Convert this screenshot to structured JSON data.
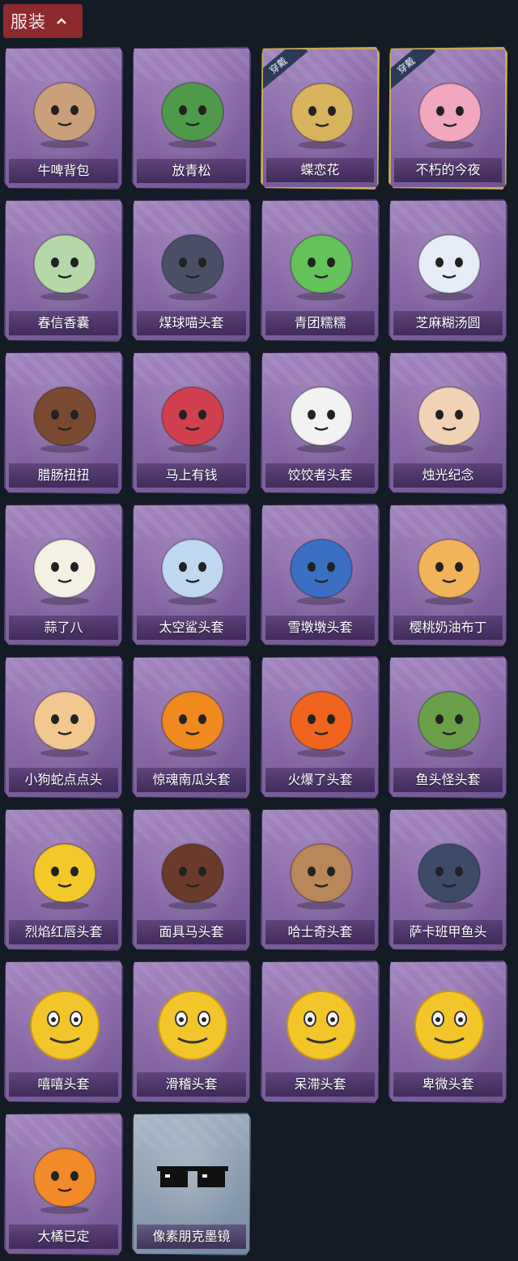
{
  "header": {
    "title": "服装"
  },
  "ribbon_text": "穿戴",
  "items": [
    {
      "name": "牛啤背包",
      "equipped": false,
      "icon": "cow-beer-keg-icon",
      "color": "#c9a07a"
    },
    {
      "name": "放青松",
      "equipped": false,
      "icon": "potted-pine-icon",
      "color": "#4e9a4a"
    },
    {
      "name": "蝶恋花",
      "equipped": true,
      "icon": "butterfly-bell-wreath-icon",
      "color": "#d8b35e"
    },
    {
      "name": "不朽的今夜",
      "equipped": true,
      "icon": "pink-cat-cup-icon",
      "color": "#f2a7c0"
    },
    {
      "name": "春信香囊",
      "equipped": false,
      "icon": "sachet-pouch-icon",
      "color": "#b6d7a8"
    },
    {
      "name": "煤球喵头套",
      "equipped": false,
      "icon": "grey-cat-head-icon",
      "color": "#4a4f66"
    },
    {
      "name": "青团糯糯",
      "equipped": false,
      "icon": "green-rice-ball-icon",
      "color": "#64c25a"
    },
    {
      "name": "芝麻糊汤圆",
      "equipped": false,
      "icon": "white-dumpling-icon",
      "color": "#e6ecf6"
    },
    {
      "name": "腊肠扭扭",
      "equipped": false,
      "icon": "sausage-dog-icon",
      "color": "#7a4a30"
    },
    {
      "name": "马上有钱",
      "equipped": false,
      "icon": "red-horse-icon",
      "color": "#d0404f"
    },
    {
      "name": "饺饺者头套",
      "equipped": false,
      "icon": "dumpling-head-icon",
      "color": "#f2f2f2"
    },
    {
      "name": "烛光纪念",
      "equipped": false,
      "icon": "candle-icon",
      "color": "#f0d2b4"
    },
    {
      "name": "蒜了八",
      "equipped": false,
      "icon": "garlic-icon",
      "color": "#f4f0e4"
    },
    {
      "name": "太空鲨头套",
      "equipped": false,
      "icon": "shark-head-icon",
      "color": "#bfd7ef"
    },
    {
      "name": "雪墩墩头套",
      "equipped": false,
      "icon": "snowman-head-icon",
      "color": "#3a6fc4"
    },
    {
      "name": "樱桃奶油布丁",
      "equipped": false,
      "icon": "pudding-icon",
      "color": "#f2b45a"
    },
    {
      "name": "小狗蛇点点头",
      "equipped": false,
      "icon": "snake-dog-icon",
      "color": "#f0c890"
    },
    {
      "name": "惊魂南瓜头套",
      "equipped": false,
      "icon": "pumpkin-head-icon",
      "color": "#f08a1e"
    },
    {
      "name": "火爆了头套",
      "equipped": false,
      "icon": "fire-head-icon",
      "color": "#f06420"
    },
    {
      "name": "鱼头怪头套",
      "equipped": false,
      "icon": "fish-mask-icon",
      "color": "#6aa04a"
    },
    {
      "name": "烈焰红唇头套",
      "equipped": false,
      "icon": "yellow-mouse-sunglasses-icon",
      "color": "#f2c82a"
    },
    {
      "name": "面具马头套",
      "equipped": false,
      "icon": "horse-mask-icon",
      "color": "#6a3a2a"
    },
    {
      "name": "哈士奇头套",
      "equipped": false,
      "icon": "husky-sunglasses-icon",
      "color": "#b8875a"
    },
    {
      "name": "萨卡班甲鱼头",
      "equipped": false,
      "icon": "fish-head-icon",
      "color": "#3e4a66"
    },
    {
      "name": "嘻嘻头套",
      "equipped": false,
      "icon": "grin-emoji-icon",
      "color": "#f2c62a"
    },
    {
      "name": "滑稽头套",
      "equipped": false,
      "icon": "smirk-emoji-icon",
      "color": "#f2c62a"
    },
    {
      "name": "呆滞头套",
      "equipped": false,
      "icon": "stare-emoji-icon",
      "color": "#f2c62a"
    },
    {
      "name": "卑微头套",
      "equipped": false,
      "icon": "humble-emoji-icon",
      "color": "#f2c62a"
    },
    {
      "name": "大橘已定",
      "equipped": false,
      "icon": "orange-slice-icon",
      "color": "#f28a2a"
    },
    {
      "name": "像素朋克墨镜",
      "equipped": false,
      "icon": "pixel-sunglasses-icon",
      "color": "#111111"
    }
  ]
}
